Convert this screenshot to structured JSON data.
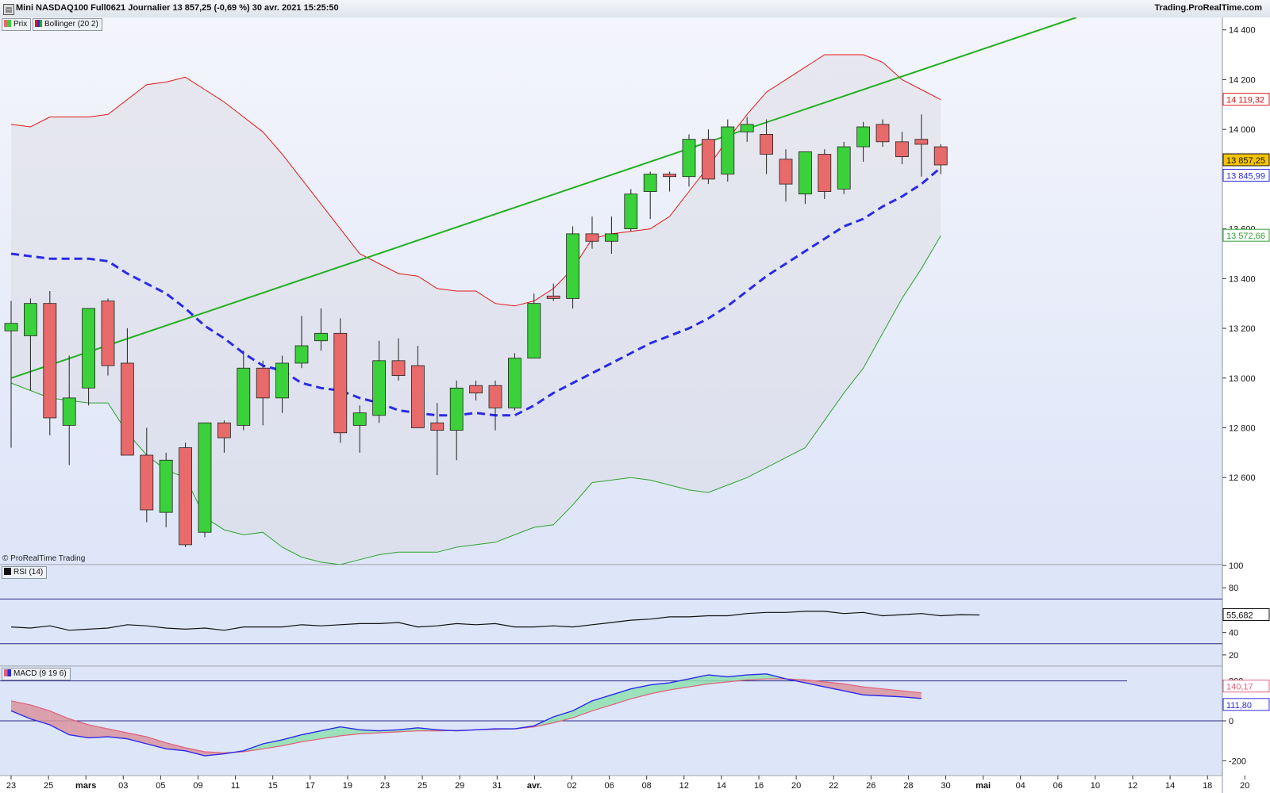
{
  "header": {
    "title": "Mini NASDAQ100 Full0621 Journalier 13 857,25 (-0,69 %) 30 avr. 2021 15:25:50",
    "brand": "Trading.ProRealTime.com",
    "logo_icon": "chart-logo-icon"
  },
  "legend": {
    "price_label": "Prix",
    "bollinger_label": "Bollinger (20 2)",
    "rsi_label": "RSI (14)",
    "macd_label": "MACD (9 19 6)",
    "credit": "© ProRealTime Trading"
  },
  "colors": {
    "up": "#3ad13a",
    "down": "#e86a6a",
    "upper_band": "#e01818",
    "lower_band": "#2fa12f",
    "middle_band": "#2a2ae8",
    "trendline": "#22b022",
    "macd": "#2a2ae8",
    "signal": "#e0607a",
    "rsi": "#111111"
  },
  "chart_data": [
    {
      "type": "candlestick",
      "title": "Mini NASDAQ100 Full0621 Journalier",
      "ylim": [
        12250,
        14450
      ],
      "y_ticks": [
        "12 600",
        "12 800",
        "13 000",
        "13 200",
        "13 400",
        "13 600",
        "14 000",
        "14 200",
        "14 400"
      ],
      "y_tick_values": [
        12600,
        12800,
        13000,
        13200,
        13400,
        13600,
        14000,
        14200,
        14400
      ],
      "x_ticks": [
        "23",
        "25",
        "mars",
        "03",
        "05",
        "09",
        "11",
        "15",
        "17",
        "19",
        "23",
        "25",
        "29",
        "31",
        "avr.",
        "02",
        "06",
        "08",
        "12",
        "14",
        "16",
        "20",
        "22",
        "26",
        "28",
        "30",
        "mai",
        "04",
        "06",
        "10",
        "12",
        "14",
        "18",
        "20"
      ],
      "price_labels": {
        "upper": "14 119,32",
        "last": "13 857,25",
        "middle": "13 845,99",
        "lower": "13 572,66"
      },
      "candles": [
        {
          "o": 13190,
          "h": 13310,
          "l": 12720,
          "c": 13220
        },
        {
          "o": 13170,
          "h": 13320,
          "l": 12950,
          "c": 13300
        },
        {
          "o": 13300,
          "h": 13350,
          "l": 12770,
          "c": 12840
        },
        {
          "o": 12810,
          "h": 13090,
          "l": 12650,
          "c": 12920
        },
        {
          "o": 12960,
          "h": 13280,
          "l": 12890,
          "c": 13280
        },
        {
          "o": 13310,
          "h": 13320,
          "l": 13010,
          "c": 13050
        },
        {
          "o": 13060,
          "h": 13200,
          "l": 12690,
          "c": 12690
        },
        {
          "o": 12690,
          "h": 12800,
          "l": 12420,
          "c": 12470
        },
        {
          "o": 12460,
          "h": 12700,
          "l": 12400,
          "c": 12670
        },
        {
          "o": 12720,
          "h": 12740,
          "l": 12320,
          "c": 12330
        },
        {
          "o": 12380,
          "h": 12820,
          "l": 12360,
          "c": 12820
        },
        {
          "o": 12820,
          "h": 12830,
          "l": 12700,
          "c": 12760
        },
        {
          "o": 12810,
          "h": 13110,
          "l": 12790,
          "c": 13040
        },
        {
          "o": 13040,
          "h": 13070,
          "l": 12810,
          "c": 12920
        },
        {
          "o": 12920,
          "h": 13090,
          "l": 12860,
          "c": 13060
        },
        {
          "o": 13060,
          "h": 13250,
          "l": 13040,
          "c": 13130
        },
        {
          "o": 13150,
          "h": 13280,
          "l": 13110,
          "c": 13180
        },
        {
          "o": 13180,
          "h": 13240,
          "l": 12740,
          "c": 12780
        },
        {
          "o": 12810,
          "h": 12890,
          "l": 12700,
          "c": 12860
        },
        {
          "o": 12850,
          "h": 13150,
          "l": 12820,
          "c": 13070
        },
        {
          "o": 13070,
          "h": 13160,
          "l": 12990,
          "c": 13010
        },
        {
          "o": 13050,
          "h": 13130,
          "l": 12800,
          "c": 12800
        },
        {
          "o": 12820,
          "h": 12900,
          "l": 12610,
          "c": 12790
        },
        {
          "o": 12790,
          "h": 12990,
          "l": 12670,
          "c": 12960
        },
        {
          "o": 12970,
          "h": 12990,
          "l": 12910,
          "c": 12940
        },
        {
          "o": 12970,
          "h": 12990,
          "l": 12790,
          "c": 12880
        },
        {
          "o": 12880,
          "h": 13100,
          "l": 12870,
          "c": 13080
        },
        {
          "o": 13080,
          "h": 13340,
          "l": 13080,
          "c": 13300
        },
        {
          "o": 13330,
          "h": 13380,
          "l": 13310,
          "c": 13320
        },
        {
          "o": 13320,
          "h": 13610,
          "l": 13280,
          "c": 13580
        },
        {
          "o": 13580,
          "h": 13650,
          "l": 13520,
          "c": 13550
        },
        {
          "o": 13550,
          "h": 13650,
          "l": 13500,
          "c": 13580
        },
        {
          "o": 13600,
          "h": 13760,
          "l": 13590,
          "c": 13740
        },
        {
          "o": 13750,
          "h": 13830,
          "l": 13640,
          "c": 13820
        },
        {
          "o": 13820,
          "h": 13830,
          "l": 13750,
          "c": 13810
        },
        {
          "o": 13810,
          "h": 13980,
          "l": 13770,
          "c": 13960
        },
        {
          "o": 13960,
          "h": 14000,
          "l": 13780,
          "c": 13800
        },
        {
          "o": 13820,
          "h": 14040,
          "l": 13790,
          "c": 14010
        },
        {
          "o": 13990,
          "h": 14050,
          "l": 13950,
          "c": 14020
        },
        {
          "o": 13980,
          "h": 14040,
          "l": 13820,
          "c": 13900
        },
        {
          "o": 13880,
          "h": 13920,
          "l": 13710,
          "c": 13780
        },
        {
          "o": 13740,
          "h": 13900,
          "l": 13700,
          "c": 13910
        },
        {
          "o": 13900,
          "h": 13920,
          "l": 13720,
          "c": 13750
        },
        {
          "o": 13760,
          "h": 13950,
          "l": 13740,
          "c": 13930
        },
        {
          "o": 13930,
          "h": 14030,
          "l": 13870,
          "c": 14010
        },
        {
          "o": 14020,
          "h": 14040,
          "l": 13930,
          "c": 13950
        },
        {
          "o": 13950,
          "h": 13990,
          "l": 13860,
          "c": 13890
        },
        {
          "o": 13960,
          "h": 14060,
          "l": 13810,
          "c": 13940
        },
        {
          "o": 13930,
          "h": 13940,
          "l": 13820,
          "c": 13857
        }
      ],
      "bollinger_upper": [
        14020,
        14010,
        14050,
        14050,
        14050,
        14060,
        14120,
        14180,
        14190,
        14210,
        14160,
        14110,
        14050,
        13990,
        13900,
        13800,
        13700,
        13600,
        13500,
        13460,
        13420,
        13410,
        13360,
        13350,
        13350,
        13300,
        13290,
        13310,
        13360,
        13440,
        13560,
        13580,
        13590,
        13600,
        13650,
        13750,
        13850,
        13960,
        14060,
        14150,
        14200,
        14250,
        14300,
        14300,
        14300,
        14270,
        14200,
        14160,
        14119.32
      ],
      "bollinger_middle": [
        13500,
        13490,
        13480,
        13480,
        13480,
        13470,
        13420,
        13380,
        13340,
        13280,
        13210,
        13160,
        13100,
        13050,
        13030,
        12980,
        12960,
        12950,
        12920,
        12900,
        12870,
        12860,
        12850,
        12850,
        12860,
        12850,
        12850,
        12890,
        12940,
        12980,
        13020,
        13060,
        13100,
        13140,
        13170,
        13200,
        13240,
        13290,
        13350,
        13410,
        13460,
        13510,
        13560,
        13610,
        13640,
        13690,
        13730,
        13780,
        13845.99
      ],
      "bollinger_lower": [
        12980,
        12950,
        12920,
        12910,
        12900,
        12900,
        12780,
        12690,
        12630,
        12600,
        12440,
        12390,
        12370,
        12380,
        12320,
        12280,
        12260,
        12250,
        12270,
        12290,
        12300,
        12300,
        12300,
        12320,
        12330,
        12340,
        12370,
        12400,
        12410,
        12490,
        12580,
        12590,
        12600,
        12590,
        12570,
        12550,
        12540,
        12570,
        12600,
        12640,
        12680,
        12720,
        12830,
        12940,
        13040,
        13180,
        13320,
        13440,
        13572.66
      ],
      "trendline": {
        "start": {
          "index": 0,
          "value": 13000
        },
        "end": {
          "index": 55,
          "value": 14450
        }
      }
    },
    {
      "type": "line",
      "title": "RSI (14)",
      "ylim": [
        10,
        100
      ],
      "y_ticks": [
        "20",
        "40",
        "80",
        "100"
      ],
      "y_tick_values": [
        20,
        40,
        80,
        100
      ],
      "levels": [
        30,
        70
      ],
      "last_label": "55,682",
      "values": [
        45,
        44,
        46,
        42,
        43,
        44,
        47,
        46,
        44,
        43,
        44,
        42,
        45,
        45,
        45,
        47,
        46,
        47,
        48,
        48,
        49,
        45,
        46,
        48,
        47,
        48,
        45,
        45,
        46,
        45,
        47,
        49,
        51,
        52,
        54,
        54,
        55,
        55,
        57,
        58,
        58,
        59,
        59,
        57,
        58,
        55,
        56,
        57,
        55,
        56,
        55.68
      ]
    },
    {
      "type": "line",
      "title": "MACD (9 19 6)",
      "ylim": [
        -270,
        270
      ],
      "y_ticks": [
        "-200",
        "0",
        "200"
      ],
      "y_tick_values": [
        -200,
        0,
        200
      ],
      "levels": [
        0,
        200
      ],
      "labels": {
        "signal": "140,17",
        "macd": "111,80"
      },
      "macd": [
        50,
        10,
        -20,
        -70,
        -85,
        -80,
        -90,
        -115,
        -140,
        -150,
        -175,
        -165,
        -150,
        -115,
        -95,
        -70,
        -50,
        -30,
        -45,
        -50,
        -45,
        -35,
        -45,
        -50,
        -45,
        -40,
        -40,
        -25,
        20,
        50,
        100,
        130,
        160,
        180,
        190,
        210,
        230,
        220,
        230,
        235,
        210,
        190,
        170,
        150,
        130,
        125,
        120,
        111.8
      ],
      "signal": [
        100,
        80,
        50,
        10,
        -20,
        -40,
        -60,
        -80,
        -110,
        -135,
        -155,
        -160,
        -155,
        -140,
        -125,
        -105,
        -90,
        -75,
        -65,
        -60,
        -55,
        -50,
        -50,
        -48,
        -45,
        -43,
        -40,
        -30,
        -10,
        15,
        50,
        80,
        110,
        135,
        155,
        170,
        185,
        195,
        205,
        210,
        210,
        205,
        195,
        185,
        170,
        160,
        150,
        140.17
      ]
    }
  ]
}
